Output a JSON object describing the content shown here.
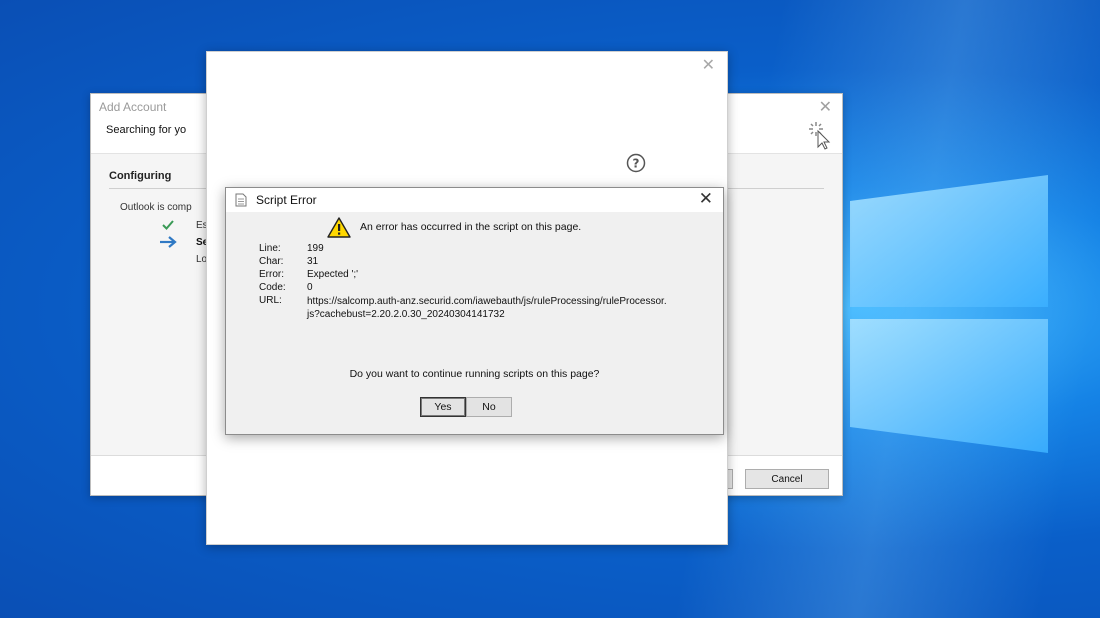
{
  "add_account": {
    "title": "Add Account",
    "subtitle": "Searching for yo",
    "section_title": "Configuring",
    "description": "Outlook is comp",
    "steps": [
      "Es",
      "Se",
      "Lo"
    ],
    "cancel_label": "Cancel"
  },
  "script_error": {
    "title": "Script Error",
    "message": "An error has occurred in the script on this page.",
    "labels": {
      "line": "Line:",
      "char": "Char:",
      "error": "Error:",
      "code": "Code:",
      "url": "URL:"
    },
    "values": {
      "line": "199",
      "char": "31",
      "error": "Expected ';'",
      "code": "0",
      "url": "https://salcomp.auth-anz.securid.com/iawebauth/js/ruleProcessing/ruleProcessor.js?cachebust=2.20.2.0.30_20240304141732"
    },
    "question": "Do you want to continue running scripts on this page?",
    "yes_label": "Yes",
    "no_label": "No"
  },
  "icons": [
    "close-icon",
    "help-icon",
    "warning-icon",
    "document-icon",
    "checkmark-icon",
    "arrow-right-icon",
    "busy-cursor-icon",
    "windows-logo"
  ],
  "colors": {
    "desktop_blue": "#0a5fc9",
    "arrow_blue": "#2f79c4",
    "check_green": "#3a9a56",
    "warning_yellow": "#ffd800"
  }
}
